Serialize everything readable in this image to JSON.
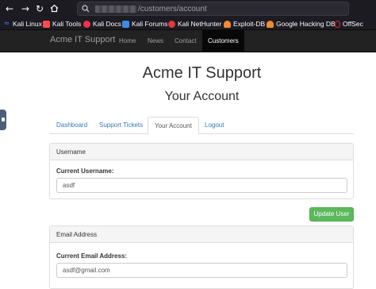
{
  "browser": {
    "url_path": "/customers/account",
    "icons": {
      "back": "arrow-left-icon",
      "forward": "arrow-right-icon",
      "reload": "reload-icon",
      "home": "home-icon",
      "search": "search-icon"
    },
    "bookmarks": [
      {
        "label": "Kali Linux",
        "icon": "kali-linux-icon",
        "color": "#367bf0"
      },
      {
        "label": "Kali Tools",
        "icon": "kali-tools-icon",
        "color": "#ff4b4b"
      },
      {
        "label": "Kali Docs",
        "icon": "kali-docs-icon",
        "color": "#f03050"
      },
      {
        "label": "Kali Forums",
        "icon": "kali-forums-icon",
        "color": "#3a8ee6"
      },
      {
        "label": "Kali NetHunter",
        "icon": "kali-nethunter-icon",
        "color": "#e03a3a"
      },
      {
        "label": "Exploit-DB",
        "icon": "exploit-db-icon",
        "color": "#f28a30"
      },
      {
        "label": "Google Hacking DB",
        "icon": "ghdb-icon",
        "color": "#f28a30"
      },
      {
        "label": "OffSec",
        "icon": "offsec-icon",
        "color": "#d4282d"
      }
    ]
  },
  "navbar": {
    "brand": "Acme IT Support",
    "links": [
      "Home",
      "News",
      "Contact",
      "Customers"
    ],
    "active": "Customers"
  },
  "page": {
    "title": "Acme IT Support",
    "subtitle": "Your Account",
    "tabs": [
      "Dashboard",
      "Support Tickets",
      "Your Account",
      "Logout"
    ],
    "active_tab": "Your Account"
  },
  "username_panel": {
    "heading": "Username",
    "label": "Current Username:",
    "value": "asdf",
    "button": "Update User"
  },
  "email_panel": {
    "heading": "Email Address",
    "label": "Current Email Address:",
    "value": "asdf@gmail.com"
  },
  "colors": {
    "accent_link": "#337ab7",
    "success_button": "#5cb85c",
    "navbar_bg": "#222222"
  }
}
